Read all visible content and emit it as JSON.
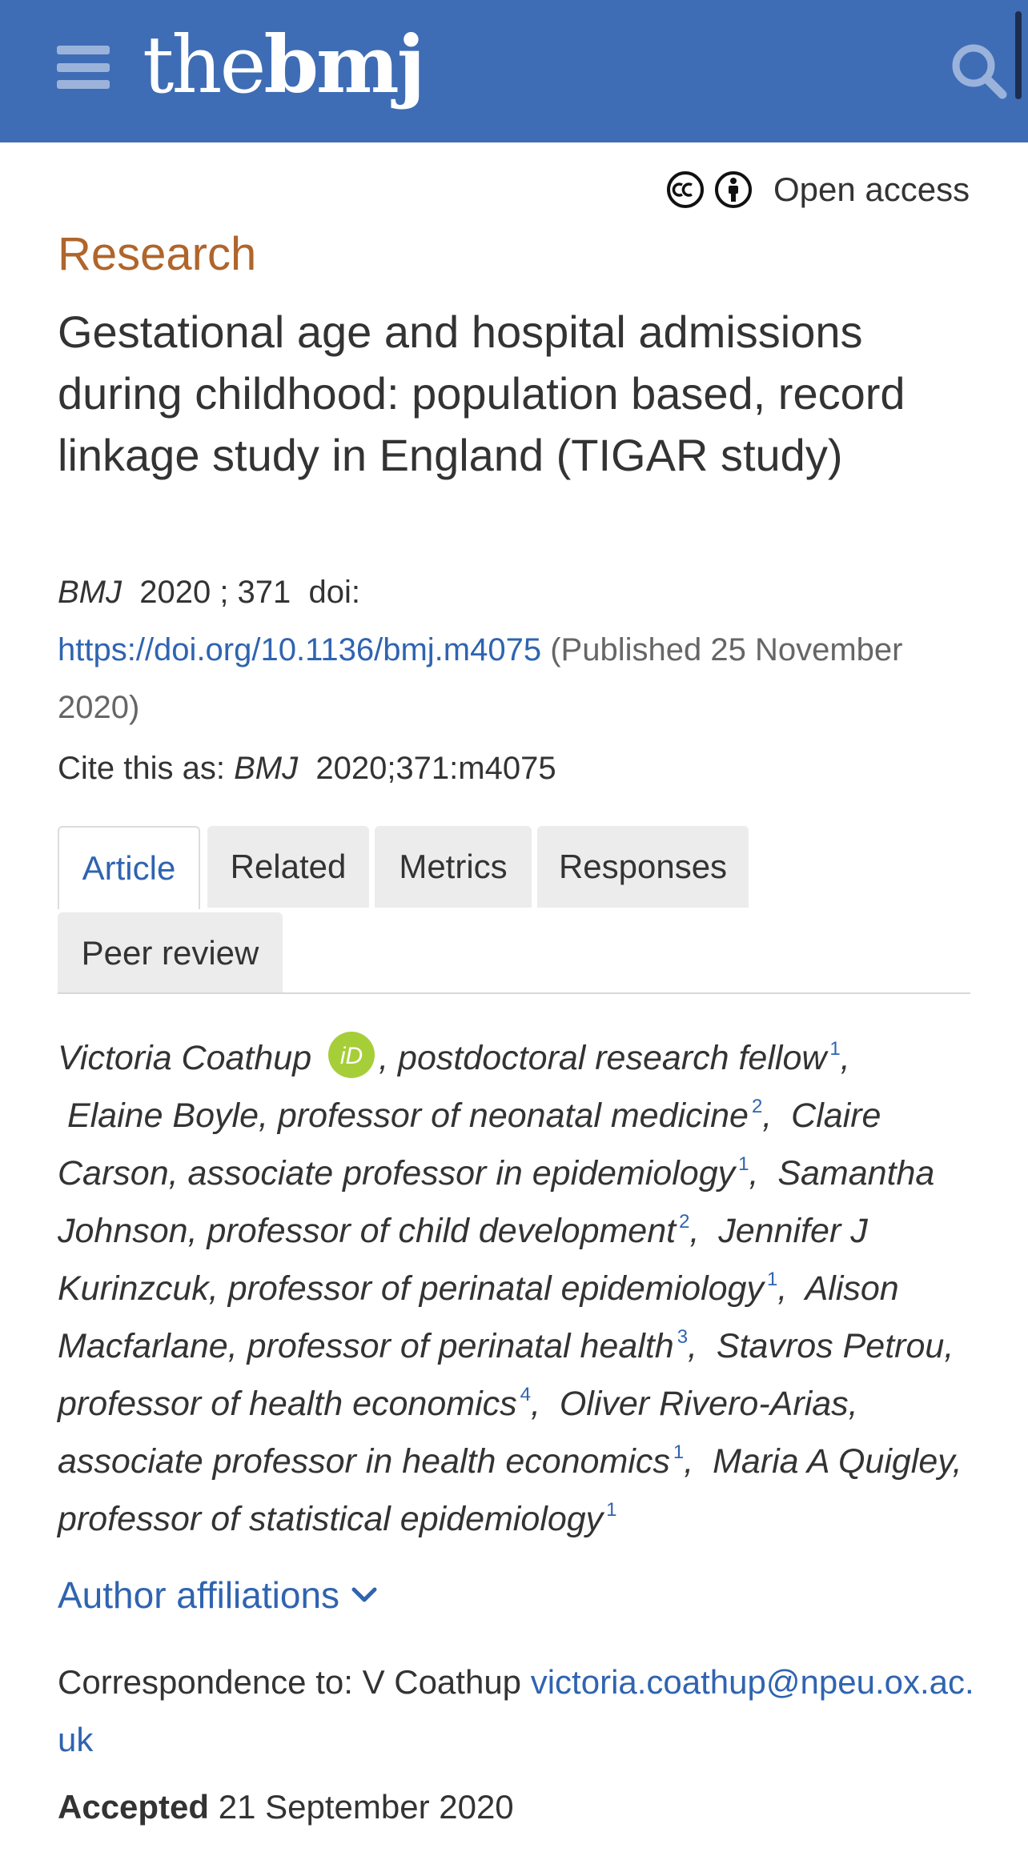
{
  "header": {
    "menu_icon": "hamburger-menu-icon",
    "logo_thin": "the",
    "logo_bold": "bmj",
    "search_icon": "search-icon",
    "background_color": "#3e6db5"
  },
  "access": {
    "label": "Open access",
    "icons": [
      "creative-commons-icon",
      "attribution-icon"
    ]
  },
  "article": {
    "section": "Research",
    "title": "Gestational age and hospital admissions during childhood: population based, record linkage study in England (TIGAR study)",
    "journal": "BMJ",
    "year_volume": "2020 ; 371",
    "doi_label": "doi:",
    "doi_link": "https://doi.org/10.1136/bmj.m4075",
    "published": "(Published 25 November 2020)",
    "cite_label": "Cite this as:",
    "cite_journal": "BMJ",
    "cite_ref": "2020;371:m4075"
  },
  "tabs": [
    {
      "label": "Article",
      "active": true
    },
    {
      "label": "Related",
      "active": false
    },
    {
      "label": "Metrics",
      "active": false
    },
    {
      "label": "Responses",
      "active": false
    },
    {
      "label": "Peer review",
      "active": false
    }
  ],
  "authors": [
    {
      "name": "Victoria Coathup",
      "role": "postdoctoral research fellow",
      "aff": "1",
      "orcid": true
    },
    {
      "name": "Elaine Boyle",
      "role": "professor of neonatal medicine",
      "aff": "2"
    },
    {
      "name": "Claire Carson",
      "role": "associate professor in epidemiology",
      "aff": "1"
    },
    {
      "name": "Samantha Johnson",
      "role": "professor of child development",
      "aff": "2"
    },
    {
      "name": "Jennifer J Kurinzcuk",
      "role": "professor of perinatal epidemiology",
      "aff": "1"
    },
    {
      "name": "Alison Macfarlane",
      "role": "professor of perinatal health",
      "aff": "3"
    },
    {
      "name": "Stavros Petrou",
      "role": "professor of health economics",
      "aff": "4"
    },
    {
      "name": "Oliver Rivero-Arias",
      "role": "associate professor in health economics",
      "aff": "1"
    },
    {
      "name": "Maria A Quigley",
      "role": "professor of statistical epidemiology",
      "aff": "1"
    }
  ],
  "orcid_label": "iD",
  "affiliations_toggle": "Author affiliations",
  "correspondence": {
    "label": "Correspondence to: V Coathup",
    "email": "victoria.coathup@npeu.ox.ac.uk"
  },
  "accepted": {
    "label": "Accepted",
    "date": "21 September 2020"
  },
  "colors": {
    "header": "#3e6db5",
    "link": "#2f64b0",
    "section_label": "#b0652b",
    "orcid": "#a6ce39",
    "tab_inactive": "#ececec"
  }
}
